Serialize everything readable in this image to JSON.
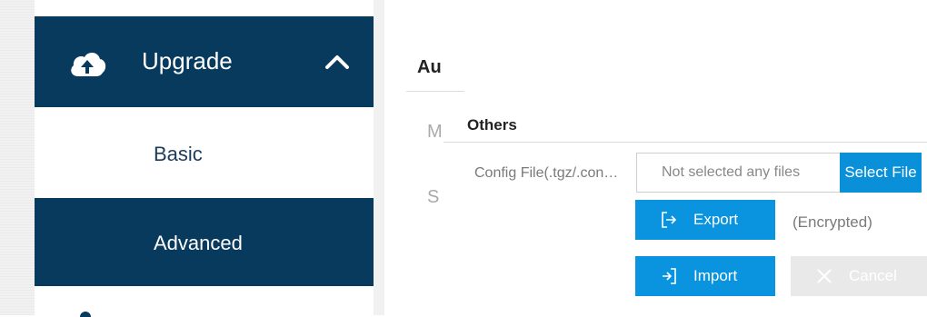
{
  "sidebar": {
    "section": {
      "label": "Upgrade",
      "icon": "cloud-upload-icon",
      "expanded_icon": "chevron-up-icon"
    },
    "items": [
      {
        "label": "Basic",
        "active": false
      },
      {
        "label": "Advanced",
        "active": true
      }
    ],
    "colors": {
      "active_bg": "#083a5e",
      "text_dark": "#1d3c5a"
    }
  },
  "main": {
    "tab_partial": "Au",
    "ghost_letters": [
      "M",
      "S"
    ]
  },
  "others": {
    "title": "Others",
    "config_label": "Config File(.tgz/.con…",
    "file_placeholder": "Not selected any files",
    "select_file_label": "Select File",
    "export_label": "Export",
    "export_icon": "export-icon",
    "encrypted_note": "(Encrypted)",
    "import_label": "Import",
    "import_icon": "import-icon",
    "cancel_label": "Cancel",
    "cancel_icon": "close-icon",
    "colors": {
      "primary": "#0a93de",
      "disabled": "#e9e9e9"
    }
  }
}
